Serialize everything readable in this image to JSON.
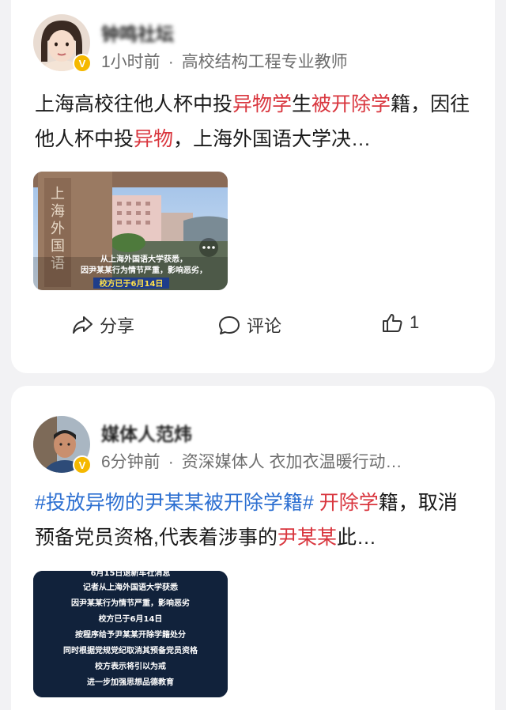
{
  "posts": [
    {
      "author": "钟鸣社坛",
      "time": "1小时前",
      "separator": "·",
      "tagline": "高校结构工程专业教师",
      "text_segments": [
        {
          "t": "上海高校往他人杯中投",
          "c": "plain"
        },
        {
          "t": "异物学",
          "c": "hl"
        },
        {
          "t": "生",
          "c": "plain"
        },
        {
          "t": "被开除学",
          "c": "hl"
        },
        {
          "t": "籍，因往他人杯中投",
          "c": "plain"
        },
        {
          "t": "异物",
          "c": "hl"
        },
        {
          "t": "，上海外国语大学决…",
          "c": "plain"
        }
      ],
      "thumb": {
        "gate_text": "上海外国语大学",
        "caption_line1": "从上海外国语大学获悉，",
        "caption_line2": "因尹某某行为情节严重，影响恶劣，",
        "caption_line3": "校方已于6月14日"
      },
      "share_label": "分享",
      "comment_label": "评论",
      "like_count": "1"
    },
    {
      "author": "媒体人范炜",
      "time": "6分钟前",
      "separator": "·",
      "tagline": "资深媒体人 衣加衣温暖行动…",
      "text_segments": [
        {
          "t": "#投放异物的尹某某被开除学籍#",
          "c": "tag"
        },
        {
          "t": " ",
          "c": "plain"
        },
        {
          "t": "开除学",
          "c": "hl"
        },
        {
          "t": "籍，取消预备党员资格,代表着涉事的",
          "c": "plain"
        },
        {
          "t": "尹某某",
          "c": "hl"
        },
        {
          "t": "此…",
          "c": "plain"
        }
      ],
      "notice_lines": [
        "6月15日退新车社消息",
        "记者从上海外国语大学获悉",
        "因尹某某行为情节严重，影响恶劣",
        "校方已于6月14日",
        "按程序给予尹某某开除学籍处分",
        "同时根据党规党纪取消其预备党员资格",
        "校方表示将引以为戒",
        "进一步加强思想品德教育"
      ]
    }
  ],
  "colors": {
    "highlight": "#d9363e",
    "topic": "#2c6fd1",
    "verified": "#f5b800"
  }
}
